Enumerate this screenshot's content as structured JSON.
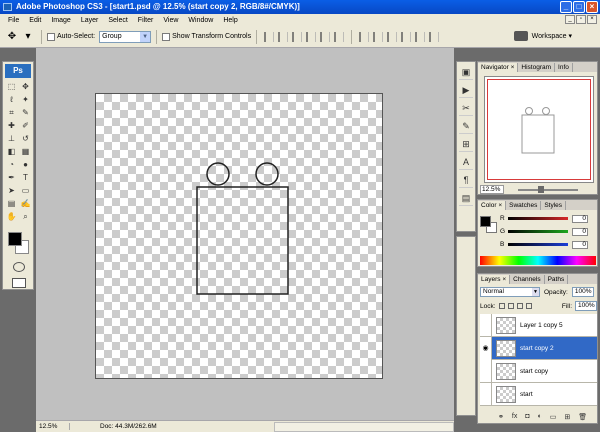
{
  "window": {
    "title": "Adobe Photoshop CS3 - [start1.psd @ 12.5% (start copy 2, RGB/8#/CMYK)]"
  },
  "menu": [
    "File",
    "Edit",
    "Image",
    "Layer",
    "Select",
    "Filter",
    "View",
    "Window",
    "Help"
  ],
  "options": {
    "auto_select_label": "Auto-Select:",
    "auto_select_value": "Group",
    "transform_label": "Show Transform Controls",
    "workspace_label": "Workspace ▾"
  },
  "toolbox": {
    "logo": "Ps"
  },
  "status": {
    "zoom": "12.5%",
    "doc": "Doc: 44.3M/262.6M"
  },
  "navigator": {
    "tabs": [
      "Navigator ×",
      "Histogram",
      "Info"
    ],
    "zoom": "12.5%"
  },
  "color_panel": {
    "tabs": [
      "Color ×",
      "Swatches",
      "Styles"
    ],
    "channels": [
      {
        "label": "R",
        "value": "0",
        "color": "#d62828"
      },
      {
        "label": "G",
        "value": "0",
        "color": "#1ea71e"
      },
      {
        "label": "B",
        "value": "0",
        "color": "#1c3ed8"
      }
    ]
  },
  "layers_panel": {
    "tabs": [
      "Layers ×",
      "Channels",
      "Paths"
    ],
    "blend_mode": "Normal",
    "opacity_label": "Opacity:",
    "opacity": "100%",
    "lock_label": "Lock:",
    "fill_label": "Fill:",
    "fill": "100%",
    "layers": [
      {
        "name": "Layer 1 copy 5",
        "visible": false,
        "selected": false
      },
      {
        "name": "start copy 2",
        "visible": true,
        "selected": true
      },
      {
        "name": "start copy",
        "visible": false,
        "selected": false
      },
      {
        "name": "start",
        "visible": false,
        "selected": false
      }
    ]
  }
}
